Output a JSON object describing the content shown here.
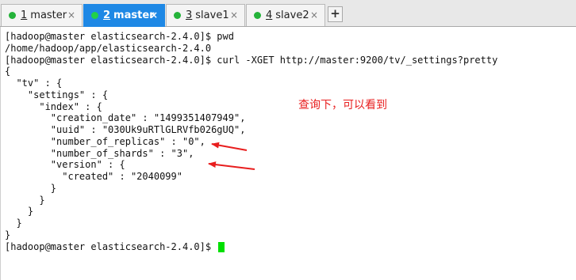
{
  "tabs": [
    {
      "num": "1",
      "label": "master",
      "close": "×",
      "active": false
    },
    {
      "num": "2",
      "label": "master",
      "close": "×",
      "active": true
    },
    {
      "num": "3",
      "label": "slave1",
      "close": "×",
      "active": false
    },
    {
      "num": "4",
      "label": "slave2",
      "close": "×",
      "active": false
    }
  ],
  "new_tab": "+",
  "terminal": {
    "lines": [
      "[hadoop@master elasticsearch-2.4.0]$ pwd",
      "/home/hadoop/app/elasticsearch-2.4.0",
      "[hadoop@master elasticsearch-2.4.0]$ curl -XGET http://master:9200/tv/_settings?pretty",
      "{",
      "  \"tv\" : {",
      "    \"settings\" : {",
      "      \"index\" : {",
      "        \"creation_date\" : \"1499351407949\",",
      "        \"uuid\" : \"030Uk9uRTlGLRVfb026gUQ\",",
      "        \"number_of_replicas\" : \"0\",",
      "        \"number_of_shards\" : \"3\",",
      "        \"version\" : {",
      "          \"created\" : \"2040099\"",
      "        }",
      "      }",
      "    }",
      "  }",
      "}",
      "[hadoop@master elasticsearch-2.4.0]$ "
    ],
    "cursor_color": "#00e000"
  },
  "annotation": {
    "text": "查询下，可以看到",
    "color": "#e81e1e"
  },
  "colors": {
    "active_tab": "#1e88e5",
    "status_dot": "#25b33a"
  }
}
